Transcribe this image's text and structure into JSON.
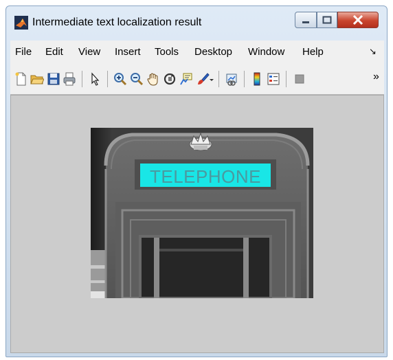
{
  "window": {
    "title": "Intermediate text localization result",
    "icon": "matlab-icon",
    "controls": [
      "minimize-icon",
      "maximize-icon",
      "close-icon"
    ]
  },
  "menu": {
    "items": [
      {
        "label": "File"
      },
      {
        "label": "Edit"
      },
      {
        "label": "View"
      },
      {
        "label": "Insert"
      },
      {
        "label": "Tools"
      },
      {
        "label": "Desktop"
      },
      {
        "label": "Window"
      },
      {
        "label": "Help"
      }
    ],
    "dock_arrow": "↘"
  },
  "toolbar": {
    "tools": [
      "new-figure-icon",
      "open-icon",
      "save-icon",
      "print-icon",
      "pointer-icon",
      "zoom-in-icon",
      "zoom-out-icon",
      "pan-icon",
      "rotate-3d-icon",
      "data-cursor-icon",
      "brush-icon",
      "link-icon",
      "colorbar-icon",
      "legend-icon",
      "hide-plot-tools-icon"
    ],
    "overflow": "»"
  },
  "figure": {
    "image": {
      "description_source": "grayscale photo of telephone box",
      "detected_text": "TELEPHONE",
      "highlight_color": "#19e6e6"
    }
  },
  "colors": {
    "figure_bg": "#cccccc",
    "menu_bg": "#f0f0f0",
    "highlight": "#19e6e6"
  }
}
